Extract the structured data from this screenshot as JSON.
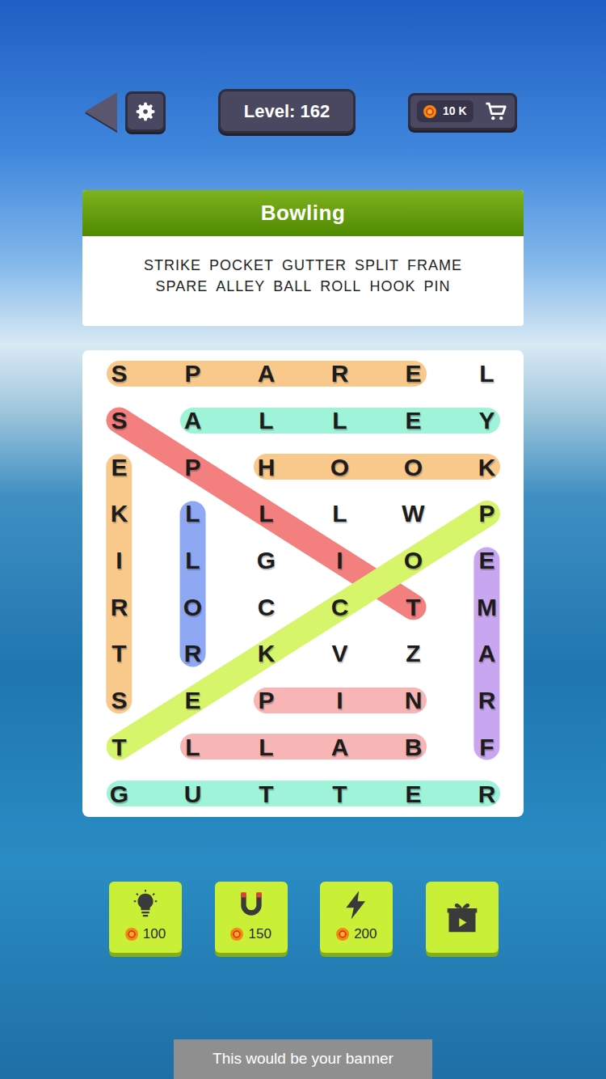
{
  "header": {
    "level": "Level: 162",
    "coins": "10 K"
  },
  "category": {
    "title": "Bowling",
    "words": [
      "STRIKE",
      "POCKET",
      "GUTTER",
      "SPLIT",
      "FRAME",
      "SPARE",
      "ALLEY",
      "BALL",
      "ROLL",
      "HOOK",
      "PIN"
    ]
  },
  "grid": {
    "rows": [
      [
        "S",
        "P",
        "A",
        "R",
        "E",
        "L"
      ],
      [
        "S",
        "A",
        "L",
        "L",
        "E",
        "Y"
      ],
      [
        "E",
        "P",
        "H",
        "O",
        "O",
        "K"
      ],
      [
        "K",
        "L",
        "L",
        "L",
        "W",
        "P"
      ],
      [
        "I",
        "L",
        "G",
        "I",
        "O",
        "E"
      ],
      [
        "R",
        "O",
        "C",
        "C",
        "T",
        "M"
      ],
      [
        "T",
        "R",
        "K",
        "V",
        "Z",
        "A"
      ],
      [
        "S",
        "E",
        "P",
        "I",
        "N",
        "R"
      ],
      [
        "T",
        "L",
        "L",
        "A",
        "B",
        "F"
      ],
      [
        "G",
        "U",
        "T",
        "T",
        "E",
        "R"
      ]
    ],
    "found": [
      {
        "start": [
          0,
          0
        ],
        "end": [
          0,
          4
        ],
        "color": "#f9c98b"
      },
      {
        "start": [
          1,
          1
        ],
        "end": [
          1,
          5
        ],
        "color": "#9ef3d8"
      },
      {
        "start": [
          2,
          2
        ],
        "end": [
          2,
          5
        ],
        "color": "#f9c98b"
      },
      {
        "start": [
          1,
          0
        ],
        "end": [
          5,
          4
        ],
        "color": "#f47f7f"
      },
      {
        "start": [
          7,
          0
        ],
        "end": [
          2,
          0
        ],
        "color": "#f9c98b"
      },
      {
        "start": [
          6,
          1
        ],
        "end": [
          3,
          1
        ],
        "color": "#8ea8f4"
      },
      {
        "start": [
          3,
          5
        ],
        "end": [
          8,
          0
        ],
        "color": "#d6f56b"
      },
      {
        "start": [
          8,
          5
        ],
        "end": [
          4,
          5
        ],
        "color": "#c9a6f0"
      },
      {
        "start": [
          7,
          2
        ],
        "end": [
          7,
          4
        ],
        "color": "#f8b5b5"
      },
      {
        "start": [
          8,
          4
        ],
        "end": [
          8,
          1
        ],
        "color": "#f8b5b5"
      },
      {
        "start": [
          9,
          0
        ],
        "end": [
          9,
          5
        ],
        "color": "#9ef3d8"
      }
    ]
  },
  "tools": [
    {
      "kind": "hint",
      "cost": "100"
    },
    {
      "kind": "magnet",
      "cost": "150"
    },
    {
      "kind": "bolt",
      "cost": "200"
    },
    {
      "kind": "video",
      "cost": ""
    }
  ],
  "banner": "This would be your banner"
}
